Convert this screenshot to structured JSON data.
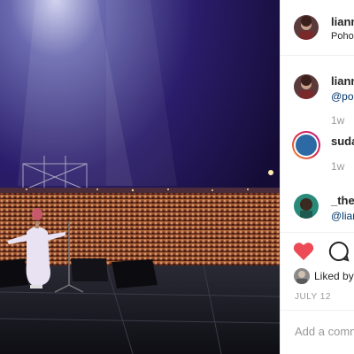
{
  "post": {
    "username": "lianne",
    "location": "Pohoda"
  },
  "comments": [
    {
      "username": "lianne",
      "text": "@pohoda",
      "time": "1w"
    },
    {
      "username": "suda",
      "text": "",
      "time": "1w"
    },
    {
      "username": "_the",
      "text": "@lian",
      "time": ""
    }
  ],
  "footer": {
    "liked_by": "Liked by",
    "date": "JULY 12",
    "add_comment_placeholder": "Add a comment…"
  },
  "colors": {
    "heart": "#ed4956",
    "link": "#003569",
    "muted": "#999999"
  }
}
